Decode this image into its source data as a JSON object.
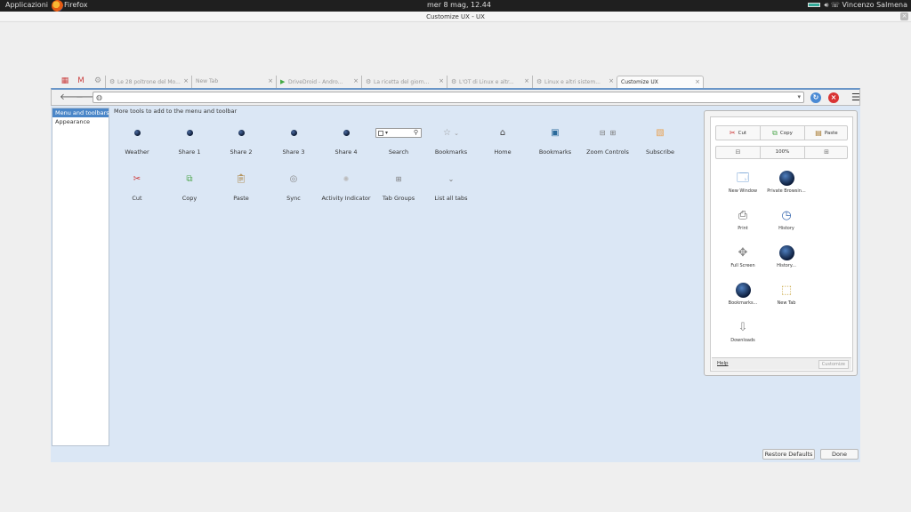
{
  "topbar": {
    "apps_label": "Applicazioni",
    "browser_label": "Firefox",
    "clock": "mer  8 mag, 12.44",
    "user": "Vincenzo Salmena"
  },
  "window": {
    "title": "Customize UX - UX"
  },
  "tabs": [
    {
      "label": "Le 28 poltrone del Mo...",
      "icon": "settings-icon"
    },
    {
      "label": "New Tab",
      "icon": ""
    },
    {
      "label": "DriveDroid - Andro...",
      "icon": "play-store-icon"
    },
    {
      "label": "La ricetta del giorn...",
      "icon": "settings-icon"
    },
    {
      "label": "L'OT di Linux e altr...",
      "icon": "settings-icon"
    },
    {
      "label": "Linux e altri sistem...",
      "icon": "settings-icon"
    },
    {
      "label": "Customize UX",
      "icon": "",
      "active": true
    }
  ],
  "sidebar": {
    "items": [
      {
        "label": "Menu and toolbars",
        "selected": true
      },
      {
        "label": "Appearance",
        "selected": false
      }
    ]
  },
  "palette": {
    "title": "More tools to add to the menu and toolbar",
    "row1": [
      {
        "label": "Weather",
        "icon": "globe-icon"
      },
      {
        "label": "Share 1",
        "icon": "globe-icon"
      },
      {
        "label": "Share 2",
        "icon": "globe-icon"
      },
      {
        "label": "Share 3",
        "icon": "globe-icon"
      },
      {
        "label": "Share 4",
        "icon": "globe-icon"
      },
      {
        "label": "Search",
        "icon": "search-box-icon"
      },
      {
        "label": "Bookmarks",
        "icon": "star-icon"
      },
      {
        "label": "Home",
        "icon": "home-icon"
      },
      {
        "label": "Bookmarks",
        "icon": "bookmarks-menu-icon"
      },
      {
        "label": "Zoom Controls",
        "icon": "zoom-icon"
      },
      {
        "label": "Subscribe",
        "icon": "rss-icon"
      }
    ],
    "row2": [
      {
        "label": "Cut",
        "icon": "scissors-icon"
      },
      {
        "label": "Copy",
        "icon": "copy-icon"
      },
      {
        "label": "Paste",
        "icon": "paste-icon"
      },
      {
        "label": "Sync",
        "icon": "sync-icon"
      },
      {
        "label": "Activity Indicator",
        "icon": "activity-icon"
      },
      {
        "label": "Tab Groups",
        "icon": "tab-groups-icon"
      },
      {
        "label": "List all tabs",
        "icon": "chevron-down-icon"
      }
    ]
  },
  "panel": {
    "edit": {
      "cut": "Cut",
      "copy": "Copy",
      "paste": "Paste"
    },
    "zoom": {
      "level": "100%"
    },
    "items": [
      {
        "label": "New Window",
        "icon": "new-window-icon"
      },
      {
        "label": "Private Browsin...",
        "icon": "private-browsing-icon"
      },
      {
        "label": "Print",
        "icon": "print-icon"
      },
      {
        "label": "History",
        "icon": "history-icon"
      },
      {
        "label": "Full Screen",
        "icon": "fullscreen-icon"
      },
      {
        "label": "History...",
        "icon": "history-globe-icon"
      },
      {
        "label": "Bookmarks...",
        "icon": "bookmarks-globe-icon"
      },
      {
        "label": "New Tab",
        "icon": "new-tab-icon"
      },
      {
        "label": "Downloads",
        "icon": "downloads-icon"
      }
    ],
    "help": "Help",
    "customize": "Customize"
  },
  "buttons": {
    "restore": "Restore Defaults",
    "done": "Done"
  },
  "colors": {
    "accent": "#4a86c8",
    "content_bg": "#dbe7f5",
    "reload": "#4a8ad4",
    "stop": "#d93434"
  }
}
